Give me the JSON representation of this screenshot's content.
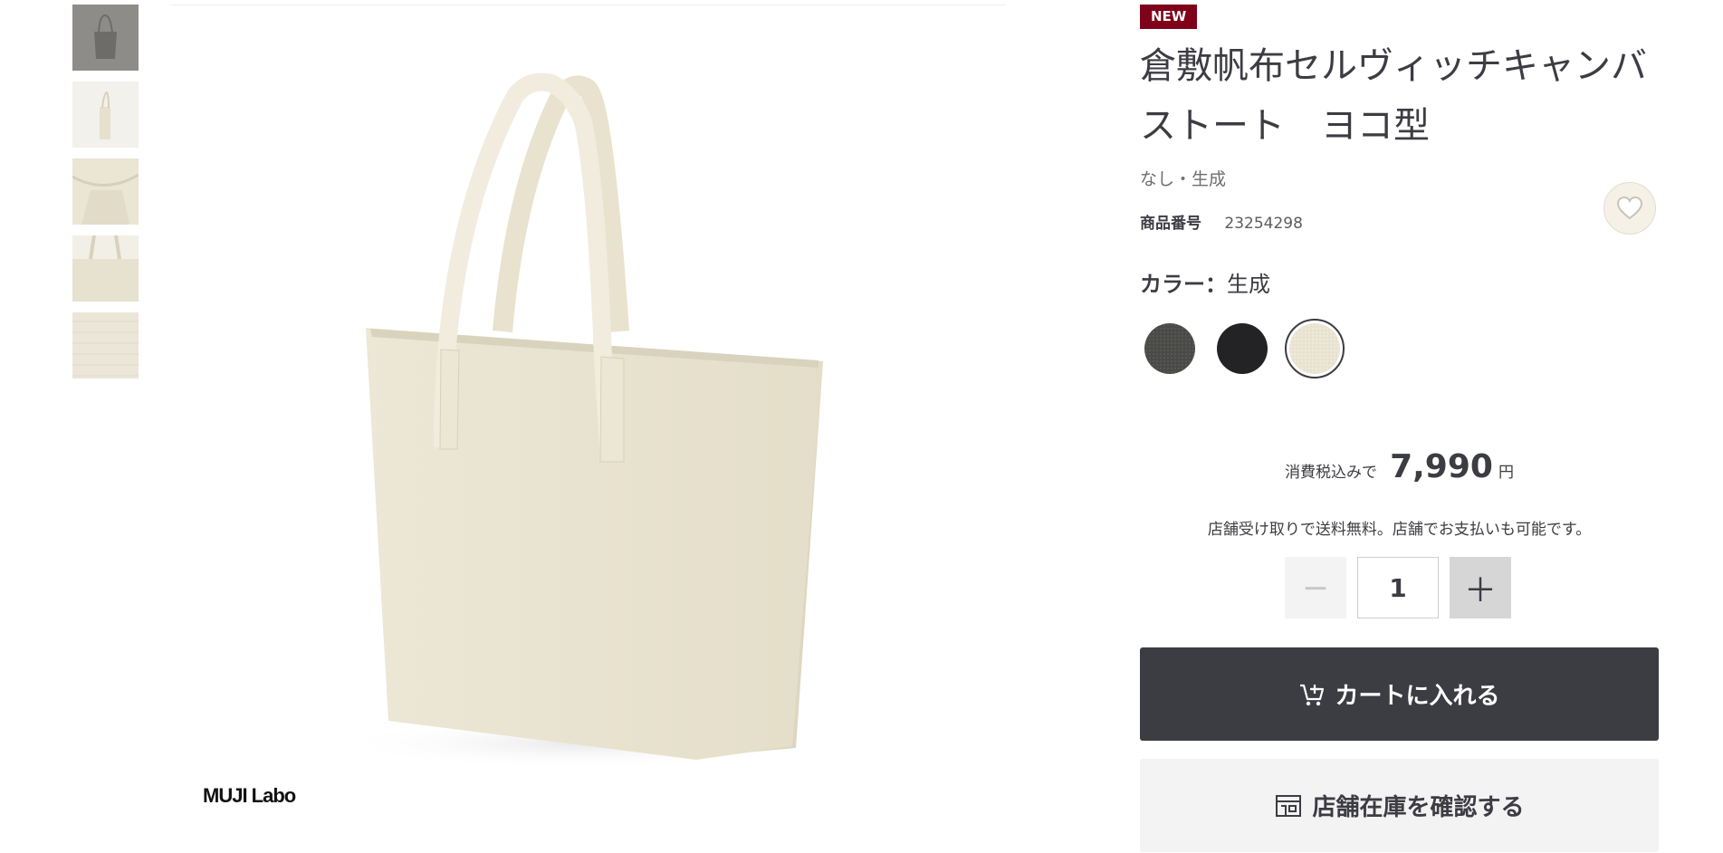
{
  "product": {
    "badge": "NEW",
    "title": "倉敷帆布セルヴィッチキャンバストート　ヨコ型",
    "variant": "なし・生成",
    "code_label": "商品番号",
    "code_value": "23254298",
    "color_label": "カラー：",
    "color_value": "生成",
    "brand_logo": "MUJI Labo"
  },
  "swatches": [
    {
      "name": "dark-gray",
      "color": "#4a4a48"
    },
    {
      "name": "black",
      "color": "#232325"
    },
    {
      "name": "natural",
      "color": "#e8e2d0",
      "selected": true
    }
  ],
  "price": {
    "prefix": "消費税込みで",
    "value": "7,990",
    "unit": "円",
    "pickup_note": "店舗受け取りで送料無料。店舗でお支払いも可能です。"
  },
  "quantity": {
    "minus": "−",
    "value": "1",
    "plus": "＋"
  },
  "actions": {
    "add_to_cart": "カートに入れる",
    "check_stock": "店舗在庫を確認する"
  },
  "colors": {
    "dark_button": "#3c3c43",
    "badge_bg": "#7f0019",
    "canvas": "#ece7d8"
  }
}
